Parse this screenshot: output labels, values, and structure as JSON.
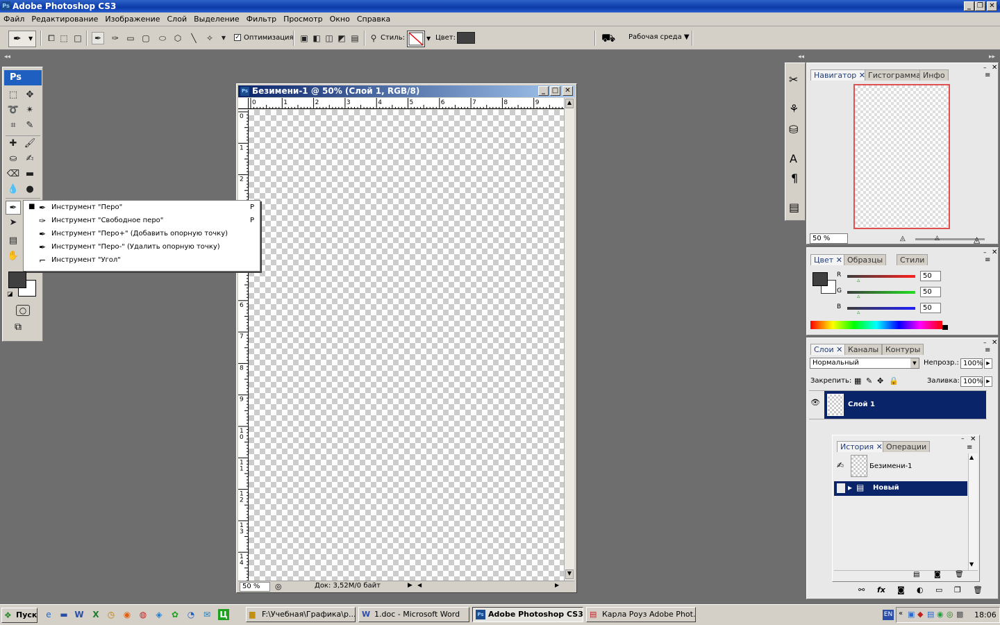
{
  "app": {
    "title": "Adobe Photoshop CS3",
    "logo": "Ps"
  },
  "menu": [
    "Файл",
    "Редактирование",
    "Изображение",
    "Слой",
    "Выделение",
    "Фильтр",
    "Просмотр",
    "Окно",
    "Справка"
  ],
  "options": {
    "optimization_label": "Оптимизация",
    "style_label": "Стиль:",
    "color_label": "Цвет:",
    "workspace_label": "Рабочая среда ▼",
    "color_value": "#404040"
  },
  "document": {
    "title": "Безимени-1 @ 50% (Слой 1, RGB/8)",
    "zoom": "50 %",
    "doc_info": "Док: 3,52М/0 байт",
    "hruler": [
      "0",
      "1",
      "2",
      "3",
      "4",
      "5",
      "6",
      "7",
      "8",
      "9"
    ],
    "vruler": [
      "0",
      "1",
      "2",
      "6",
      "7",
      "8",
      "9",
      "1\n0",
      "1\n1",
      "1\n2",
      "1\n3",
      "1\n4"
    ]
  },
  "popup": {
    "items": [
      {
        "label": "Инструмент \"Перо\"",
        "key": "P",
        "checked": "■"
      },
      {
        "label": "Инструмент \"Свободное перо\"",
        "key": "P",
        "checked": ""
      },
      {
        "label": "Инструмент \"Перо+\" (Добавить опорную точку)",
        "key": "",
        "checked": ""
      },
      {
        "label": "Инструмент \"Перо-\" (Удалить опорную точку)",
        "key": "",
        "checked": ""
      },
      {
        "label": "Инструмент \"Угол\"",
        "key": "",
        "checked": ""
      }
    ]
  },
  "navigator": {
    "tabs": [
      "Навигатор",
      "Гистограмма",
      "Инфо"
    ],
    "zoom": "50 %"
  },
  "color_panel": {
    "tabs": [
      "Цвет",
      "Образцы",
      "Стили"
    ],
    "channels": [
      {
        "label": "R",
        "value": "50"
      },
      {
        "label": "G",
        "value": "50"
      },
      {
        "label": "B",
        "value": "50"
      }
    ]
  },
  "layers": {
    "tabs": [
      "Слои",
      "Каналы",
      "Контуры"
    ],
    "blend_mode": "Нормальный",
    "opacity_label": "Непрозр.:",
    "opacity": "100%",
    "lock_label": "Закрепить:",
    "fill_label": "Заливка:",
    "fill": "100%",
    "layer_name": "Слой 1"
  },
  "history": {
    "tabs": [
      "История",
      "Операции"
    ],
    "snapshot": "Безимени-1",
    "step": "Новый"
  },
  "taskbar": {
    "start": "Пуск",
    "buttons": [
      "F:\\Учебная\\Графика\\р...",
      "1.doc - Microsoft Word",
      "Adobe Photoshop CS3",
      "Карла Роуз Adobe Phot..."
    ],
    "lang": "EN",
    "clock": "18:06"
  }
}
